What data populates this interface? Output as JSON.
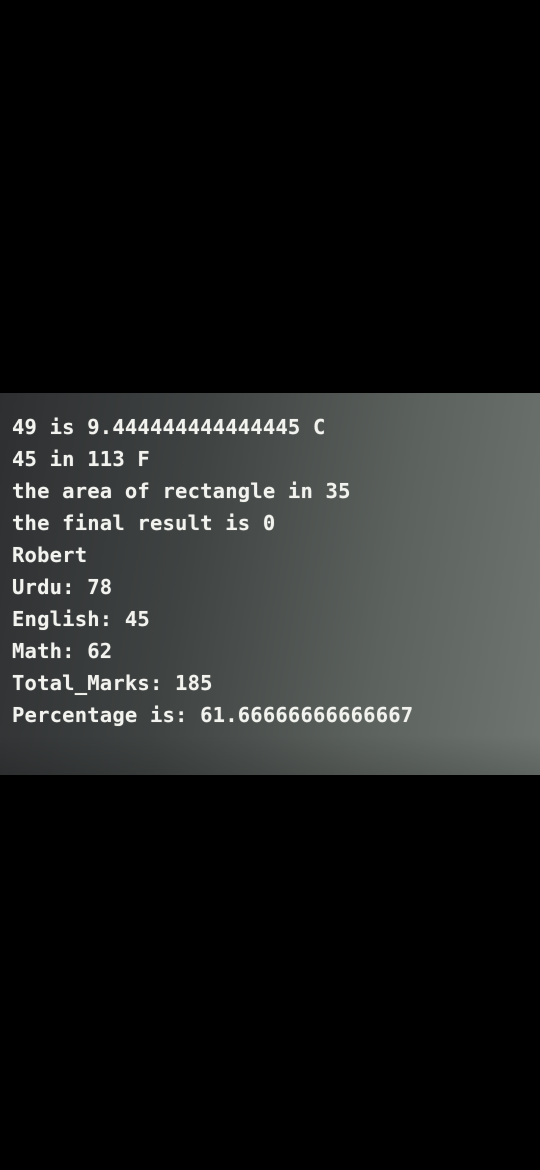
{
  "terminal": {
    "lines": [
      "49 is 9.444444444444445 C",
      "45 in 113 F",
      "the area of rectangle in 35",
      "the final result is 0",
      "Robert",
      "Urdu: 78",
      "English: 45",
      "Math: 62",
      "Total_Marks: 185",
      "Percentage is: 61.66666666666667"
    ]
  },
  "colors": {
    "background": "#000000",
    "terminal_text": "#f2f3ef",
    "terminal_bg_dark": "#2e2f31",
    "terminal_bg_light": "#6f7671"
  }
}
